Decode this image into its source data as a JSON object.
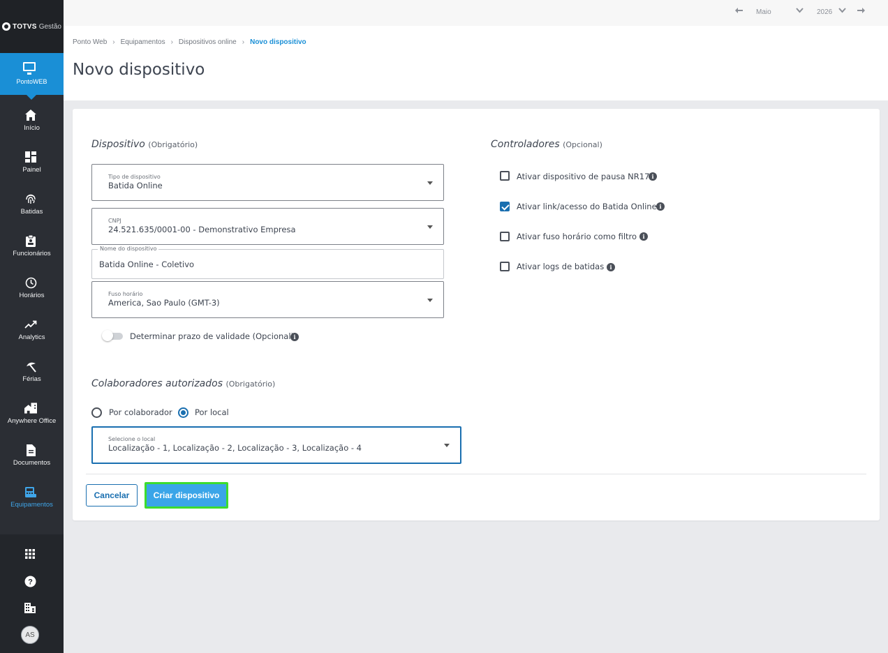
{
  "brand": {
    "name_bold": "TOTVS",
    "name_light": "Gestão"
  },
  "product": {
    "label": "PontoWEB"
  },
  "nav": [
    {
      "label": "Início",
      "icon": "home-icon"
    },
    {
      "label": "Painel",
      "icon": "dashboard-icon"
    },
    {
      "label": "Batidas",
      "icon": "fingerprint-icon"
    },
    {
      "label": "Funcionários",
      "icon": "badge-icon"
    },
    {
      "label": "Horários",
      "icon": "clock-icon"
    },
    {
      "label": "Analytics",
      "icon": "trending-icon"
    },
    {
      "label": "Férias",
      "icon": "beach-icon"
    },
    {
      "label": "Anywhere Office",
      "icon": "home-work-icon"
    },
    {
      "label": "Documentos",
      "icon": "document-icon"
    },
    {
      "label": "Equipamentos",
      "icon": "device-icon"
    }
  ],
  "user": {
    "initials": "AS"
  },
  "topbar": {
    "month": "Maio",
    "year": "2026"
  },
  "breadcrumb": [
    "Ponto Web",
    "Equipamentos",
    "Dispositivos online",
    "Novo dispositivo"
  ],
  "page_title": "Novo dispositivo",
  "dispositivo": {
    "title": "Dispositivo",
    "qualifier": "(Obrigatório)",
    "tipo": {
      "label": "Tipo de dispositivo",
      "value": "Batida Online"
    },
    "cnpj": {
      "label": "CNPJ",
      "value": "24.521.635/0001-00 - Demonstrativo Empresa"
    },
    "nome": {
      "label": "Nome do dispositivo",
      "value": "Batida Online - Coletivo"
    },
    "fuso": {
      "label": "Fuso horário",
      "value": "America, Sao Paulo (GMT-3)"
    },
    "validade_label": "Determinar prazo de validade (Opcional)"
  },
  "colaboradores": {
    "title": "Colaboradores autorizados",
    "qualifier": "(Obrigatório)",
    "radio_a": "Por colaborador",
    "radio_b": "Por local",
    "local": {
      "label": "Selecione o local",
      "value": "Localização - 1, Localização - 2, Localização - 3, Localização - 4"
    }
  },
  "controladores": {
    "title": "Controladores",
    "qualifier": "(Opcional)",
    "items": [
      {
        "label": "Ativar dispositivo de pausa NR17",
        "checked": false
      },
      {
        "label": "Ativar link/acesso do Batida Online",
        "checked": true
      },
      {
        "label": "Ativar fuso horário como filtro",
        "checked": false
      },
      {
        "label": "Ativar logs de batidas",
        "checked": false
      }
    ]
  },
  "actions": {
    "cancel": "Cancelar",
    "create": "Criar dispositivo"
  },
  "colors": {
    "accent": "#1a8fd6",
    "sidebar": "#2b2e34",
    "highlight": "#3ddc2e"
  }
}
